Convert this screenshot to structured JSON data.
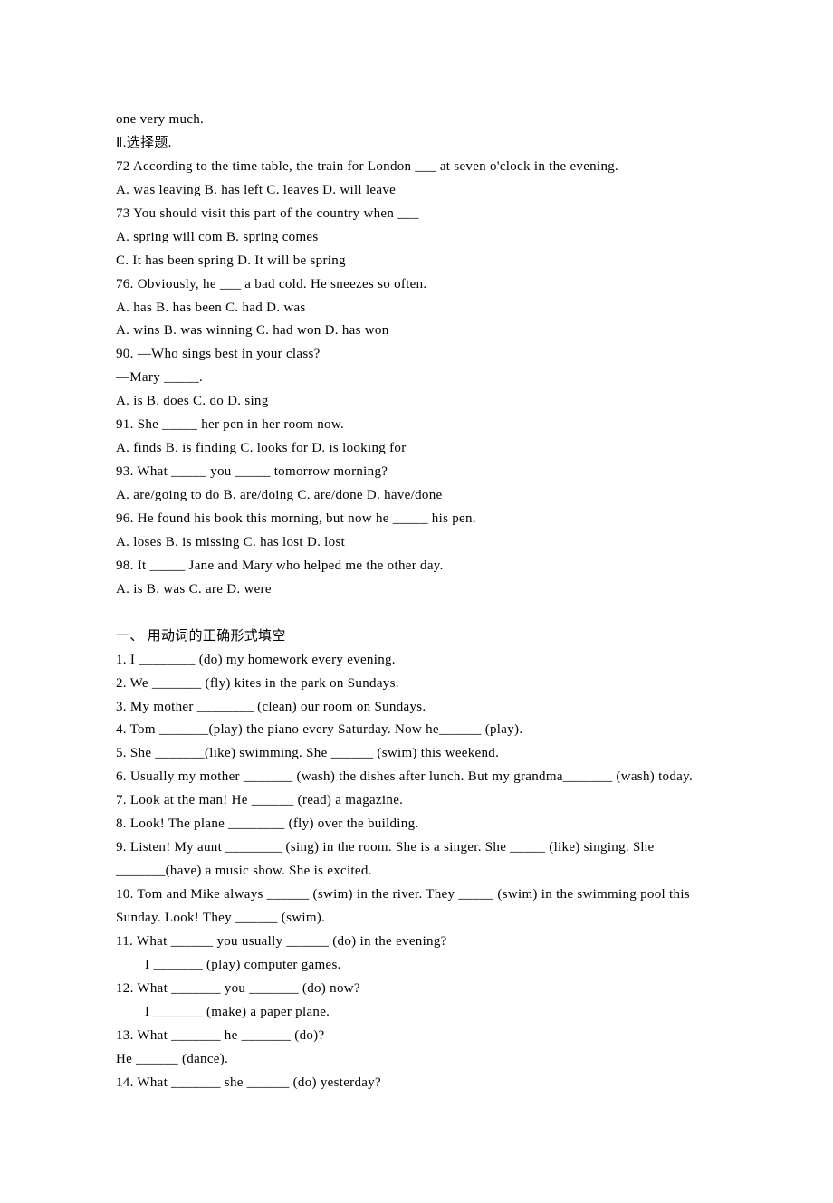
{
  "top_line": "one very much.",
  "section2": {
    "heading": "Ⅱ.选择题.",
    "items": [
      {
        "text": "72 According to the time table, the train for London ___ at seven o'clock in the evening."
      },
      {
        "text": "A. was leaving B. has left C. leaves D. will leave"
      },
      {
        "text": "73 You should visit this part of the country when ___"
      },
      {
        "text": "A. spring will com B. spring comes"
      },
      {
        "text": "C. It has been spring D. It will be spring"
      },
      {
        "text": "76. Obviously, he ___ a bad cold. He sneezes so often."
      },
      {
        "text": "A. has B. has been C. had D. was"
      },
      {
        "text": "A. wins B. was winning C. had won D. has won"
      },
      {
        "text": "90. —Who sings best in your class?"
      },
      {
        "text": "—Mary _____."
      },
      {
        "text": "A. is B. does C. do D. sing"
      },
      {
        "text": "91. She _____ her pen in her room now."
      },
      {
        "text": "A. finds B. is finding C. looks for D. is looking for"
      },
      {
        "text": "93. What _____ you _____ tomorrow morning?"
      },
      {
        "text": "A. are/going to do B. are/doing C. are/done D. have/done"
      },
      {
        "text": "96. He found his book this morning, but now he _____ his pen."
      },
      {
        "text": "A. loses B. is missing C. has lost D. lost"
      },
      {
        "text": "98. It _____ Jane and Mary who helped me the other day."
      },
      {
        "text": "A. is B. was C. are D. were"
      }
    ]
  },
  "section3": {
    "heading": "一、 用动词的正确形式填空",
    "items": [
      {
        "text": "1. I ________ (do) my homework every evening."
      },
      {
        "text": "2. We _______ (fly) kites in the park on Sundays."
      },
      {
        "text": "3. My mother ________ (clean) our room on Sundays."
      },
      {
        "text": "4. Tom _______(play) the piano every Saturday. Now he______ (play)."
      },
      {
        "text": "5. She _______(like) swimming. She ______ (swim) this weekend."
      },
      {
        "text": "6. Usually my mother _______ (wash) the dishes after lunch. But my grandma_______ (wash) today."
      },
      {
        "text": "7. Look at the man! He ______ (read) a magazine."
      },
      {
        "text": "8. Look! The plane ________ (fly) over the building."
      },
      {
        "text": "9. Listen! My aunt ________ (sing) in the room. She is a singer. She _____ (like) singing. She _______(have) a music show. She is excited."
      },
      {
        "text": "10. Tom and Mike always ______ (swim) in the river. They _____ (swim) in the swimming pool this Sunday. Look! They ______ (swim)."
      },
      {
        "text": "11. What ______ you usually ______ (do) in the evening?"
      },
      {
        "text": "I _______ (play) computer games.",
        "indent": true
      },
      {
        "text": "12. What _______ you _______ (do) now?"
      },
      {
        "text": "I _______ (make) a paper plane.",
        "indent": true
      },
      {
        "text": "13. What _______ he _______ (do)?"
      },
      {
        "text": "He ______ (dance)."
      },
      {
        "text": "14. What _______ she ______ (do) yesterday?"
      }
    ]
  }
}
